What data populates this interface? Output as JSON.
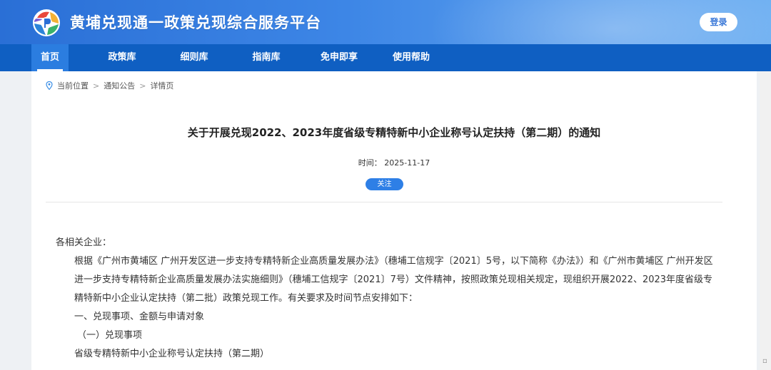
{
  "header": {
    "site_title": "黄埔兑现通一政策兑现综合服务平台",
    "login_label": "登录"
  },
  "nav": {
    "items": [
      {
        "label": "首页"
      },
      {
        "label": "政策库"
      },
      {
        "label": "细则库"
      },
      {
        "label": "指南库"
      },
      {
        "label": "免申即享"
      },
      {
        "label": "使用帮助"
      }
    ]
  },
  "breadcrumb": {
    "prefix": "当前位置",
    "items": [
      "通知公告",
      "详情页"
    ],
    "separator": ">"
  },
  "article": {
    "title": "关于开展兑现2022、2023年度省级专精特新中小企业称号认定扶持（第二期）的通知",
    "time_label": "时间：",
    "time_value": "2025-11-17",
    "follow_label": "关注",
    "salutation": "各相关企业：",
    "paragraph1": "根据《广州市黄埔区 广州开发区进一步支持专精特新企业高质量发展办法》（穗埔工信规字〔2021〕5号，以下简称《办法》）和《广州市黄埔区 广州开发区进一步支持专精特新企业高质量发展办法实施细则》（穗埔工信规字〔2021〕7号）文件精神，按照政策兑现相关规定，现组织开展2022、2023年度省级专精特新中小企业认定扶持（第二批）政策兑现工作。有关要求及时间节点安排如下：",
    "section1": "一、兑现事项、金额与申请对象",
    "subsection1": "（一）兑现事项",
    "item1": "省级专精特新中小企业称号认定扶持（第二期）"
  },
  "colors": {
    "header_start": "#2a6fd6",
    "nav_bg": "#0f5fc2",
    "accent": "#2e7fe6"
  }
}
